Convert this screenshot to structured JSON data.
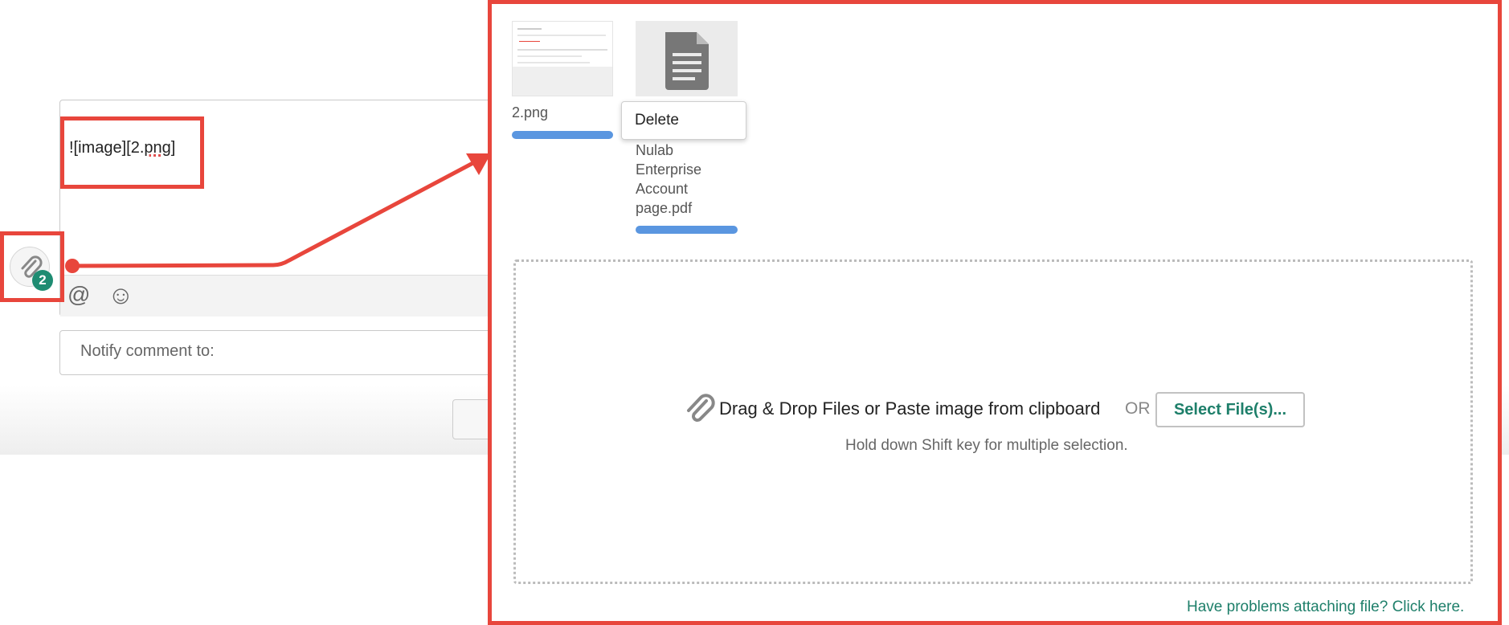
{
  "editor": {
    "content_prefix": "![image][2.",
    "content_spell": "png",
    "content_suffix": "]"
  },
  "toolbar": {
    "mention_symbol": "@",
    "emoji_symbol": "☺"
  },
  "attach": {
    "badge_count": "2"
  },
  "notify": {
    "label": "Notify comment to:"
  },
  "popup": {
    "files": [
      {
        "name": "2.png",
        "upload_progress": 1.0
      },
      {
        "name_lines": [
          "Nulab",
          "Enterprise",
          "Account",
          "page.pdf"
        ],
        "upload_progress": 1.0
      }
    ],
    "context_menu": {
      "delete_label": "Delete"
    },
    "dropzone": {
      "text": "Drag & Drop Files or Paste image from clipboard",
      "or_label": "OR",
      "select_button": "Select File(s)...",
      "hint": "Hold down Shift key for multiple selection."
    },
    "help_link": "Have problems attaching file? Click here."
  },
  "colors": {
    "annotation": "#e8463c",
    "accent": "#1e8c72",
    "progress": "#5a96e0"
  },
  "icons": [
    "paperclip-icon",
    "at-icon",
    "emoji-icon",
    "document-icon"
  ]
}
